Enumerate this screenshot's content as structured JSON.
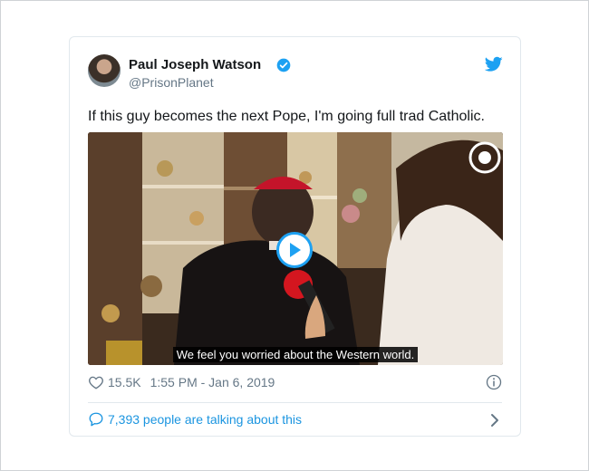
{
  "tweet": {
    "author_name": "Paul Joseph Watson",
    "author_handle": "@PrisonPlanet",
    "text": "If this guy becomes the next Pope, I'm going full trad Catholic.",
    "video_caption": "We feel you worried about the Western world.",
    "likes": "15.5K",
    "timestamp": "1:55 PM - Jan 6, 2019",
    "talking": "7,393 people are talking about this"
  },
  "icons": {
    "verified": "verified-badge-icon",
    "brand": "twitter-bird-icon",
    "play": "play-icon",
    "like": "heart-icon",
    "info": "info-icon",
    "conversation": "speech-bubble-icon",
    "next": "chevron-right-icon"
  },
  "colors": {
    "accent": "#1da1f2",
    "link": "#1b95e0",
    "muted": "#657786",
    "text": "#14171a",
    "border": "#e1e8ed"
  }
}
